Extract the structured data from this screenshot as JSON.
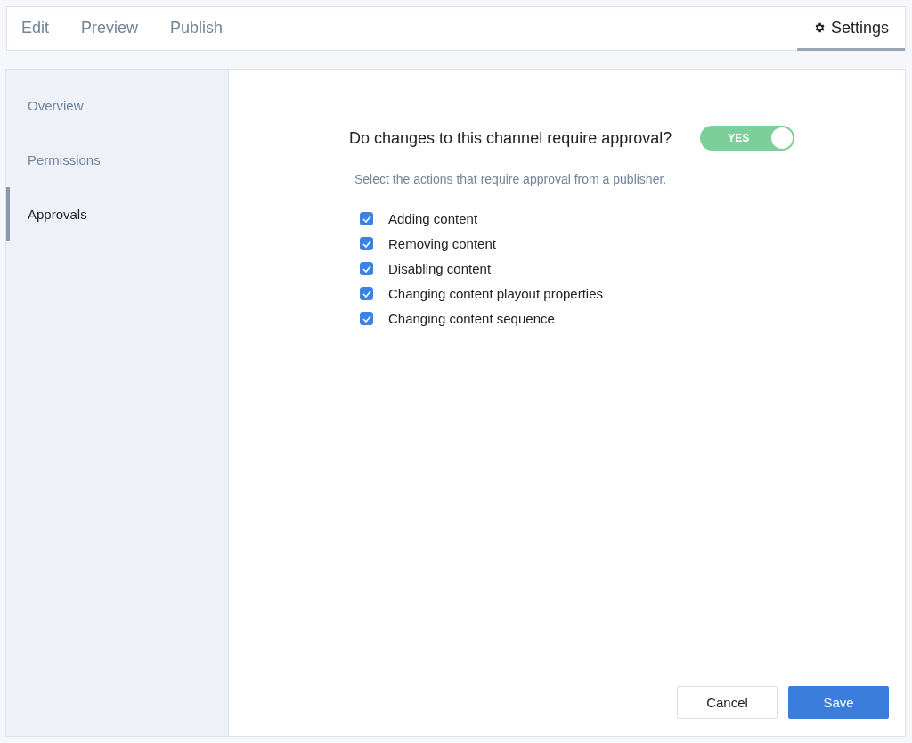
{
  "tabs": [
    {
      "label": "Edit",
      "selected": false,
      "icon": false
    },
    {
      "label": "Preview",
      "selected": false,
      "icon": false
    },
    {
      "label": "Publish",
      "selected": false,
      "icon": false
    },
    {
      "label": "Settings",
      "selected": true,
      "icon": true
    }
  ],
  "sidebar": {
    "items": [
      {
        "label": "Overview",
        "selected": false
      },
      {
        "label": "Permissions",
        "selected": false
      },
      {
        "label": "Approvals",
        "selected": true
      }
    ]
  },
  "approval": {
    "question": "Do changes to this channel require approval?",
    "toggle": {
      "on": true,
      "label": "YES"
    },
    "hint": "Select the actions that require approval from a publisher.",
    "actions": [
      {
        "label": "Adding content",
        "checked": true
      },
      {
        "label": "Removing content",
        "checked": true
      },
      {
        "label": "Disabling content",
        "checked": true
      },
      {
        "label": "Changing content playout properties",
        "checked": true
      },
      {
        "label": "Changing content sequence",
        "checked": true
      }
    ]
  },
  "buttons": [
    {
      "label": "Cancel",
      "kind": "secondary"
    },
    {
      "label": "Save",
      "kind": "primary"
    }
  ]
}
